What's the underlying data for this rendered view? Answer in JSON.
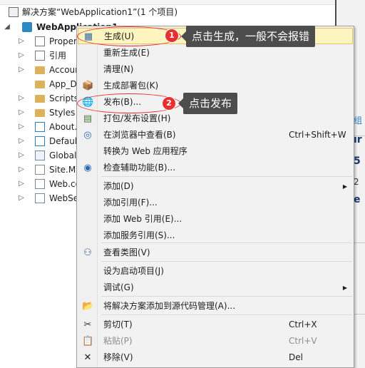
{
  "tree": {
    "solution_label": "解决方案“WebApplication1”(1 个项目)",
    "project_label": "WebApplication1",
    "items": [
      {
        "label": "Properties",
        "icon": "properties-icon"
      },
      {
        "label": "引用",
        "icon": "references-icon"
      },
      {
        "label": "Account",
        "icon": "folder-icon"
      },
      {
        "label": "App_Data",
        "icon": "folder-icon"
      },
      {
        "label": "Scripts",
        "icon": "folder-icon"
      },
      {
        "label": "Styles",
        "icon": "folder-icon"
      },
      {
        "label": "About.aspx",
        "icon": "aspx-file-icon"
      },
      {
        "label": "Default.aspx",
        "icon": "aspx-file-icon"
      },
      {
        "label": "Global.asax",
        "icon": "global-asax-icon"
      },
      {
        "label": "Site.Master",
        "icon": "master-page-icon"
      },
      {
        "label": "Web.config",
        "icon": "config-file-icon"
      },
      {
        "label": "WebSettings",
        "icon": "config-file-icon"
      }
    ]
  },
  "context_menu": {
    "items": [
      {
        "label": "生成(U)",
        "shortcut": "",
        "icon": "build-icon"
      },
      {
        "label": "重新生成(E)",
        "shortcut": "",
        "icon": ""
      },
      {
        "label": "清理(N)",
        "shortcut": "",
        "icon": ""
      },
      {
        "label": "生成部署包(K)",
        "shortcut": "",
        "icon": "package-icon"
      },
      {
        "label": "发布(B)...",
        "shortcut": "",
        "icon": "publish-icon"
      },
      {
        "label": "打包/发布设置(H)",
        "shortcut": "",
        "icon": "package-settings-icon"
      },
      {
        "label": "在浏览器中查看(B)",
        "shortcut": "Ctrl+Shift+W",
        "icon": "browser-icon"
      },
      {
        "label": "转换为 Web 应用程序",
        "shortcut": "",
        "icon": ""
      },
      {
        "label": "检查辅助功能(B)...",
        "shortcut": "",
        "icon": "accessibility-icon"
      },
      {
        "label": "添加(D)",
        "shortcut": "",
        "icon": ""
      },
      {
        "label": "添加引用(F)...",
        "shortcut": "",
        "icon": ""
      },
      {
        "label": "添加 Web 引用(E)...",
        "shortcut": "",
        "icon": ""
      },
      {
        "label": "添加服务引用(S)...",
        "shortcut": "",
        "icon": ""
      },
      {
        "label": "查看类图(V)",
        "shortcut": "",
        "icon": "class-diagram-icon"
      },
      {
        "label": "设为启动项目(J)",
        "shortcut": "",
        "icon": ""
      },
      {
        "label": "调试(G)",
        "shortcut": "",
        "icon": ""
      },
      {
        "label": "将解决方案添加到源代码管理(A)...",
        "shortcut": "",
        "icon": "source-control-icon"
      },
      {
        "label": "剪切(T)",
        "shortcut": "Ctrl+X",
        "icon": "cut-icon"
      },
      {
        "label": "粘贴(P)",
        "shortcut": "Ctrl+V",
        "icon": "paste-icon"
      },
      {
        "label": "移除(V)",
        "shortcut": "Del",
        "icon": "remove-icon"
      }
    ]
  },
  "annotations": {
    "badge1": "1",
    "callout1": "点击生成，一般不会报错",
    "badge2": "2",
    "callout2": "点击发布"
  },
  "right_pane": {
    "fragments": [
      "组",
      "ır",
      "5",
      "2",
      "e"
    ]
  },
  "colors": {
    "highlight_bg": "#fdf4bf",
    "annotation_red": "#e8312f",
    "callout_bg": "#4d4d4d"
  }
}
